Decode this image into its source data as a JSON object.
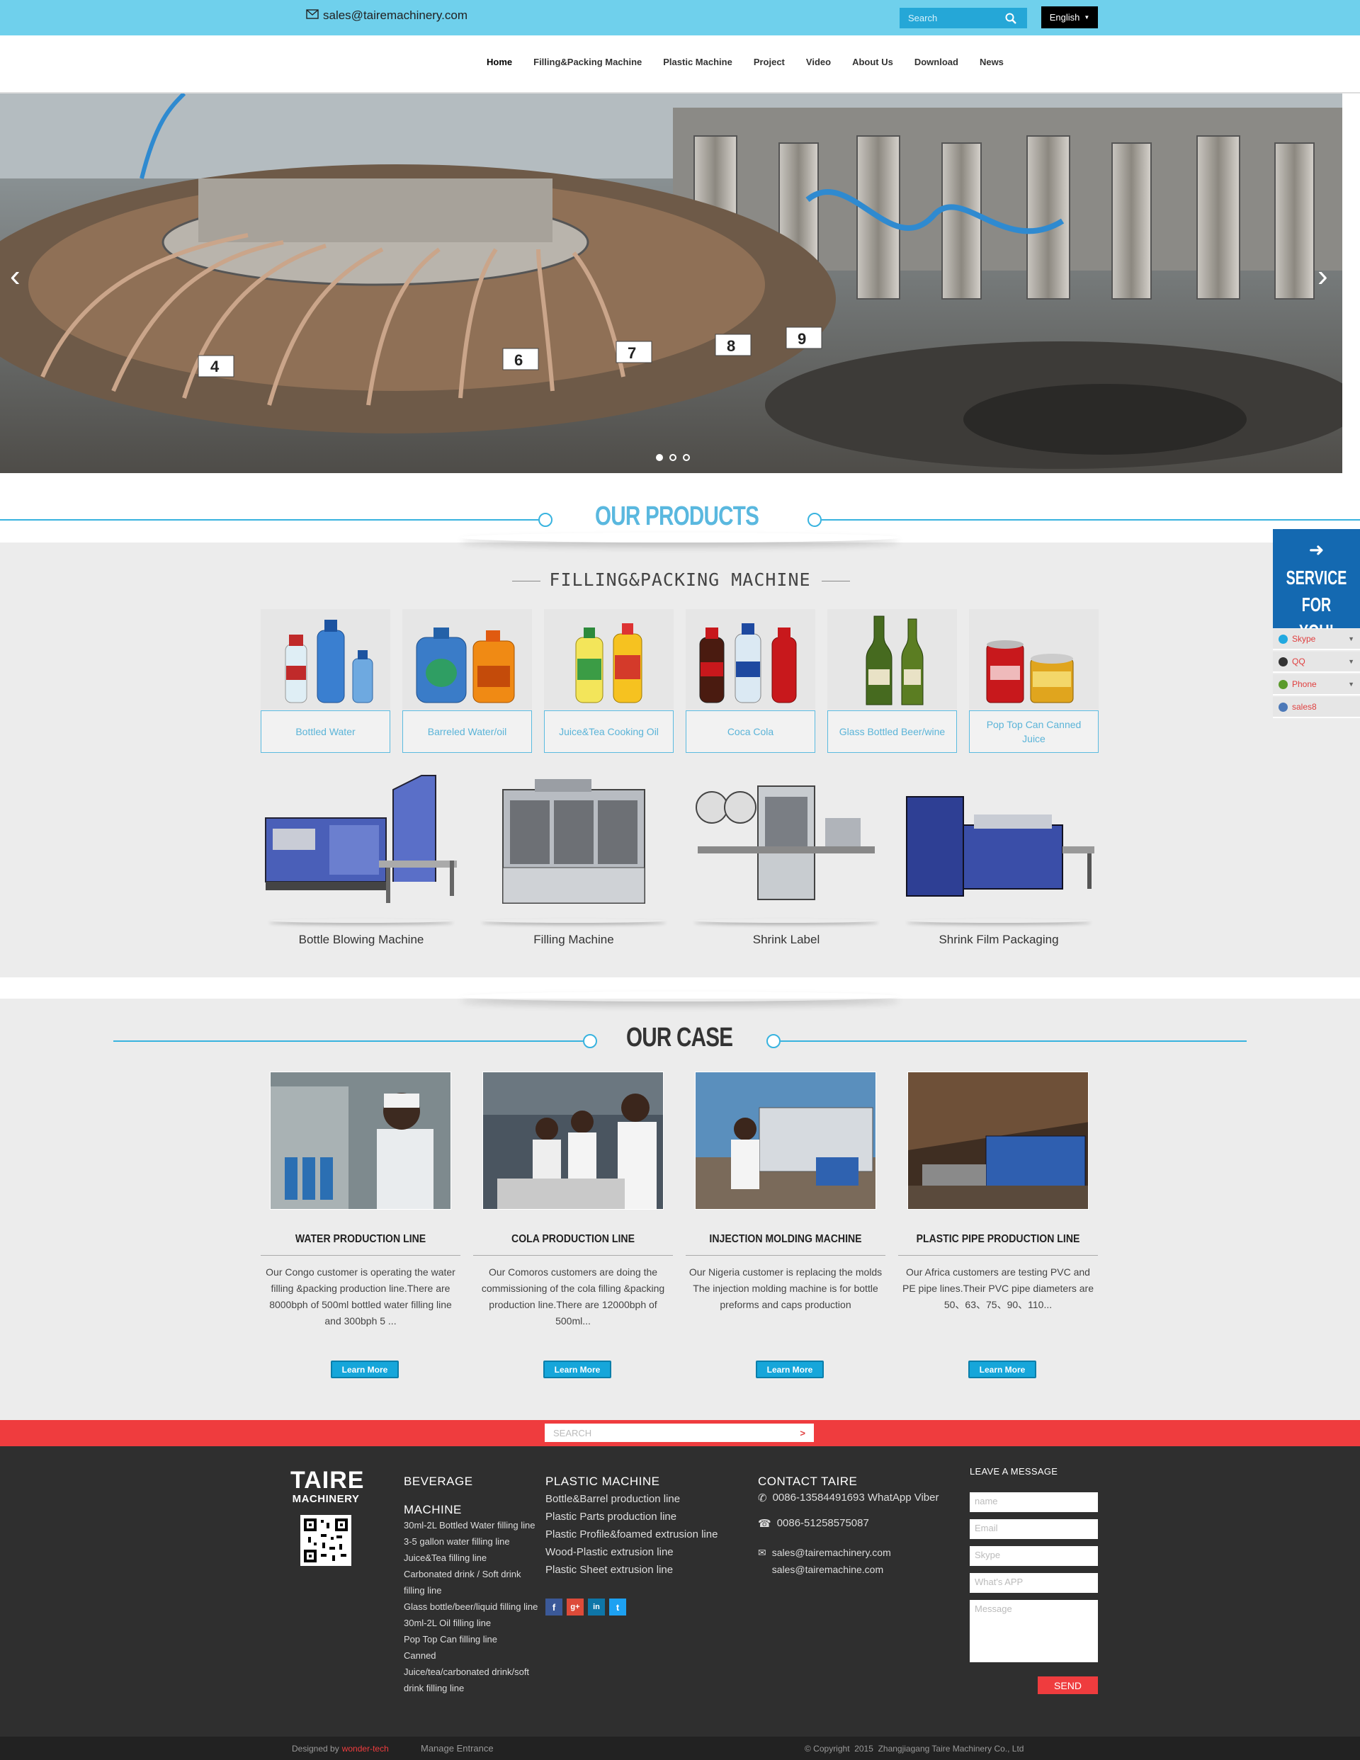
{
  "topbar": {
    "email": "sales@tairemachinery.com",
    "search_placeholder": "Search",
    "language": "English"
  },
  "nav": {
    "items": [
      "Home",
      "Filling&Packing Machine",
      "Plastic Machine",
      "Project",
      "Video",
      "About Us",
      "Download",
      "News"
    ]
  },
  "products": {
    "title": "OUR PRODUCTS",
    "subtitle": "FILLING&PACKING MACHINE",
    "categories": [
      {
        "label": "Bottled Water"
      },
      {
        "label": "Barreled Water/oil"
      },
      {
        "label": "Juice&Tea Cooking Oil"
      },
      {
        "label": "Coca Cola"
      },
      {
        "label": "Glass Bottled Beer/wine"
      },
      {
        "label": "Pop Top Can Canned Juice"
      }
    ],
    "machines": [
      {
        "label": "Bottle Blowing Machine"
      },
      {
        "label": "Filling Machine"
      },
      {
        "label": "Shrink Label"
      },
      {
        "label": "Shrink Film Packaging"
      }
    ]
  },
  "cases": {
    "title": "OUR CASE",
    "items": [
      {
        "title": "WATER PRODUCTION LINE",
        "desc": "Our Congo customer is operating the water filling &packing production line.There are 8000bph of 500ml bottled water filling line and 300bph 5 ...",
        "button": "Learn More"
      },
      {
        "title": "COLA PRODUCTION LINE",
        "desc": "Our Comoros customers are doing the commissioning of the cola filling &packing production line.There are 12000bph of 500ml...",
        "button": "Learn More"
      },
      {
        "title": "INJECTION MOLDING MACHINE",
        "desc": "Our Nigeria customer is replacing the molds The injection molding machine is for bottle preforms and caps production",
        "button": "Learn More"
      },
      {
        "title": "PLASTIC PIPE PRODUCTION LINE",
        "desc": "Our Africa customers are testing PVC and PE pipe lines.Their PVC pipe diameters are 50、63、75、90、110...",
        "button": "Learn More"
      }
    ]
  },
  "service": {
    "title_line1": "SERVICE",
    "title_line2": "FOR YOU!",
    "items": [
      "Skype",
      "QQ",
      "Phone",
      "sales8"
    ]
  },
  "footer": {
    "search_placeholder": "SEARCH",
    "logo_line1": "TAIRE",
    "logo_line2": "MACHINERY",
    "beverage": {
      "heading_line1": "BEVERAGE",
      "heading_line2": "MACHINE",
      "items": [
        "30ml-2L Bottled Water filling line",
        "3-5 gallon water filling line",
        "Juice&Tea filling line",
        "Carbonated drink / Soft drink filling line",
        "Glass bottle/beer/liquid filling line",
        "30ml-2L Oil filling line",
        "Pop Top Can filling line",
        "Canned",
        "Juice/tea/carbonated drink/soft drink filling line"
      ]
    },
    "plastic": {
      "heading": "PLASTIC MACHINE",
      "items": [
        "Bottle&Barrel production line",
        "Plastic Parts production line",
        "Plastic Profile&foamed extrusion line",
        "Wood-Plastic extrusion line",
        "Plastic Sheet extrusion line"
      ]
    },
    "contact": {
      "heading": "CONTACT TAIRE",
      "phone1": "0086-13584491693 WhatApp Viber",
      "phone2": "0086-51258575087",
      "email1": "sales@tairemachinery.com",
      "email2": "sales@tairemachine.com"
    },
    "message": {
      "heading": "LEAVE A MESSAGE",
      "name_placeholder": "name",
      "email_placeholder": "Email",
      "skype_placeholder": "Skype",
      "whatsapp_placeholder": "What's APP",
      "message_placeholder": "Message",
      "send": "SEND"
    },
    "bottom": {
      "designed_by": "Designed by",
      "designer": "wonder-tech",
      "manage": "Manage Entrance",
      "copyright": "© Copyright  2015  Zhangjiagang Taire Machinery Co., Ltd"
    }
  },
  "colors": {
    "topbar": "#6fd0ec",
    "accent_blue": "#38b3df",
    "service_blue": "#1469b1",
    "footer_red": "#ef3c3e",
    "footer_dark": "#2f2f2f"
  }
}
